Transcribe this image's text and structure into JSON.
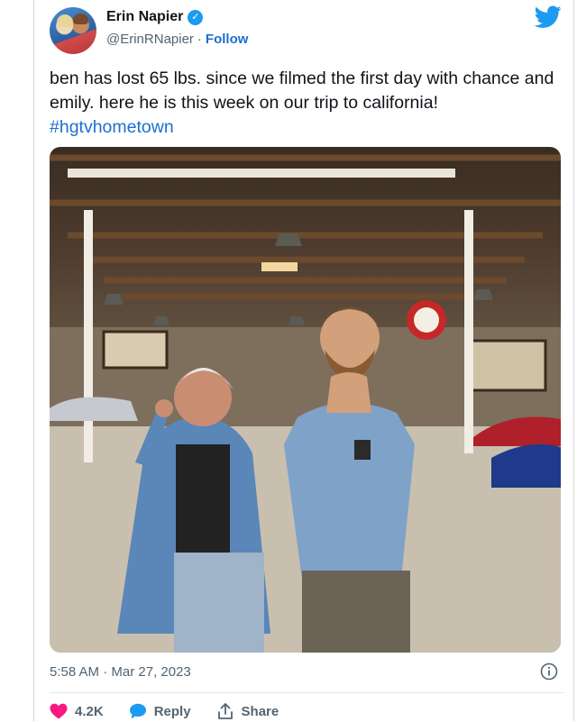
{
  "header": {
    "display_name": "Erin Napier",
    "handle": "@ErinRNapier",
    "separator": "·",
    "follow_label": "Follow",
    "verified_glyph": "✓"
  },
  "tweet": {
    "text": "ben has lost 65 lbs. since we filmed the first day with chance and emily. here he is this week on our trip to california!",
    "hashtag": "#hgtvhometown"
  },
  "meta": {
    "time": "5:58 AM",
    "separator": "·",
    "date": "Mar 27, 2023"
  },
  "actions": {
    "likes": "4.2K",
    "reply_label": "Reply",
    "share_label": "Share"
  },
  "icons": {
    "brand": "twitter-bird-icon",
    "verified": "verified-badge-icon",
    "info": "info-icon",
    "like": "heart-icon",
    "reply": "reply-bubble-icon",
    "share": "share-icon"
  },
  "colors": {
    "accent": "#1d9bf0",
    "link": "#1d6fd0",
    "like": "#f91880",
    "muted": "#536471"
  }
}
